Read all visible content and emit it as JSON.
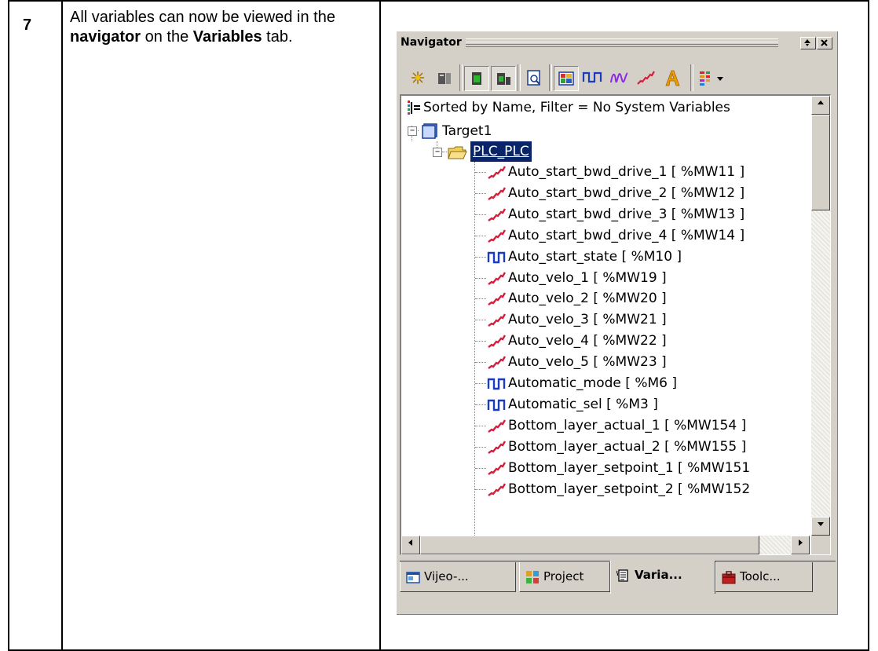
{
  "step": {
    "number": "7",
    "text_before": "All variables can now be viewed in the ",
    "bold1": "navigator",
    "text_middle": " on the ",
    "bold2": "Variables",
    "text_after": " tab."
  },
  "navigator": {
    "title": "Navigator",
    "minimize_glyph": "▴▾",
    "close_glyph": "x",
    "toolbar": [
      {
        "icon": "sparkle-icon"
      },
      {
        "icon": "device-icon"
      },
      {
        "icon": "green-panel-icon"
      },
      {
        "icon": "panels-icon"
      },
      {
        "icon": "find-icon"
      },
      {
        "icon": "table-view-icon"
      },
      {
        "icon": "digital-signal-icon"
      },
      {
        "icon": "wave-icon"
      },
      {
        "icon": "analog-signal-icon"
      },
      {
        "icon": "text-icon"
      },
      {
        "icon": "sort-filter-icon"
      }
    ],
    "tree": {
      "header": "Sorted by Name, Filter = No System Variables",
      "target": "Target1",
      "folder": "PLC_PLC",
      "variables": [
        {
          "label": "Auto_start_bwd_drive_1  [ %MW11 ]",
          "kind": "analog"
        },
        {
          "label": "Auto_start_bwd_drive_2  [ %MW12 ]",
          "kind": "analog"
        },
        {
          "label": "Auto_start_bwd_drive_3  [ %MW13 ]",
          "kind": "analog"
        },
        {
          "label": "Auto_start_bwd_drive_4  [ %MW14 ]",
          "kind": "analog"
        },
        {
          "label": "Auto_start_state  [ %M10 ]",
          "kind": "digital"
        },
        {
          "label": "Auto_velo_1  [ %MW19 ]",
          "kind": "analog"
        },
        {
          "label": "Auto_velo_2  [ %MW20 ]",
          "kind": "analog"
        },
        {
          "label": "Auto_velo_3  [ %MW21 ]",
          "kind": "analog"
        },
        {
          "label": "Auto_velo_4  [ %MW22 ]",
          "kind": "analog"
        },
        {
          "label": "Auto_velo_5  [ %MW23 ]",
          "kind": "analog"
        },
        {
          "label": "Automatic_mode  [ %M6 ]",
          "kind": "digital"
        },
        {
          "label": "Automatic_sel  [ %M3 ]",
          "kind": "digital"
        },
        {
          "label": "Bottom_layer_actual_1  [ %MW154 ]",
          "kind": "analog"
        },
        {
          "label": "Bottom_layer_actual_2  [ %MW155 ]",
          "kind": "analog"
        },
        {
          "label": "Bottom_layer_setpoint_1  [ %MW151",
          "kind": "analog"
        },
        {
          "label": "Bottom_layer_setpoint_2  [ %MW152",
          "kind": "analog"
        }
      ]
    },
    "tabs": [
      {
        "label": "Vijeo-...",
        "icon": "window-icon",
        "active": false
      },
      {
        "label": "Project",
        "icon": "project-icon",
        "active": false
      },
      {
        "label": "Varia...",
        "icon": "variables-icon",
        "active": true
      },
      {
        "label": "Toolc...",
        "icon": "toolchest-icon",
        "active": false
      }
    ]
  }
}
